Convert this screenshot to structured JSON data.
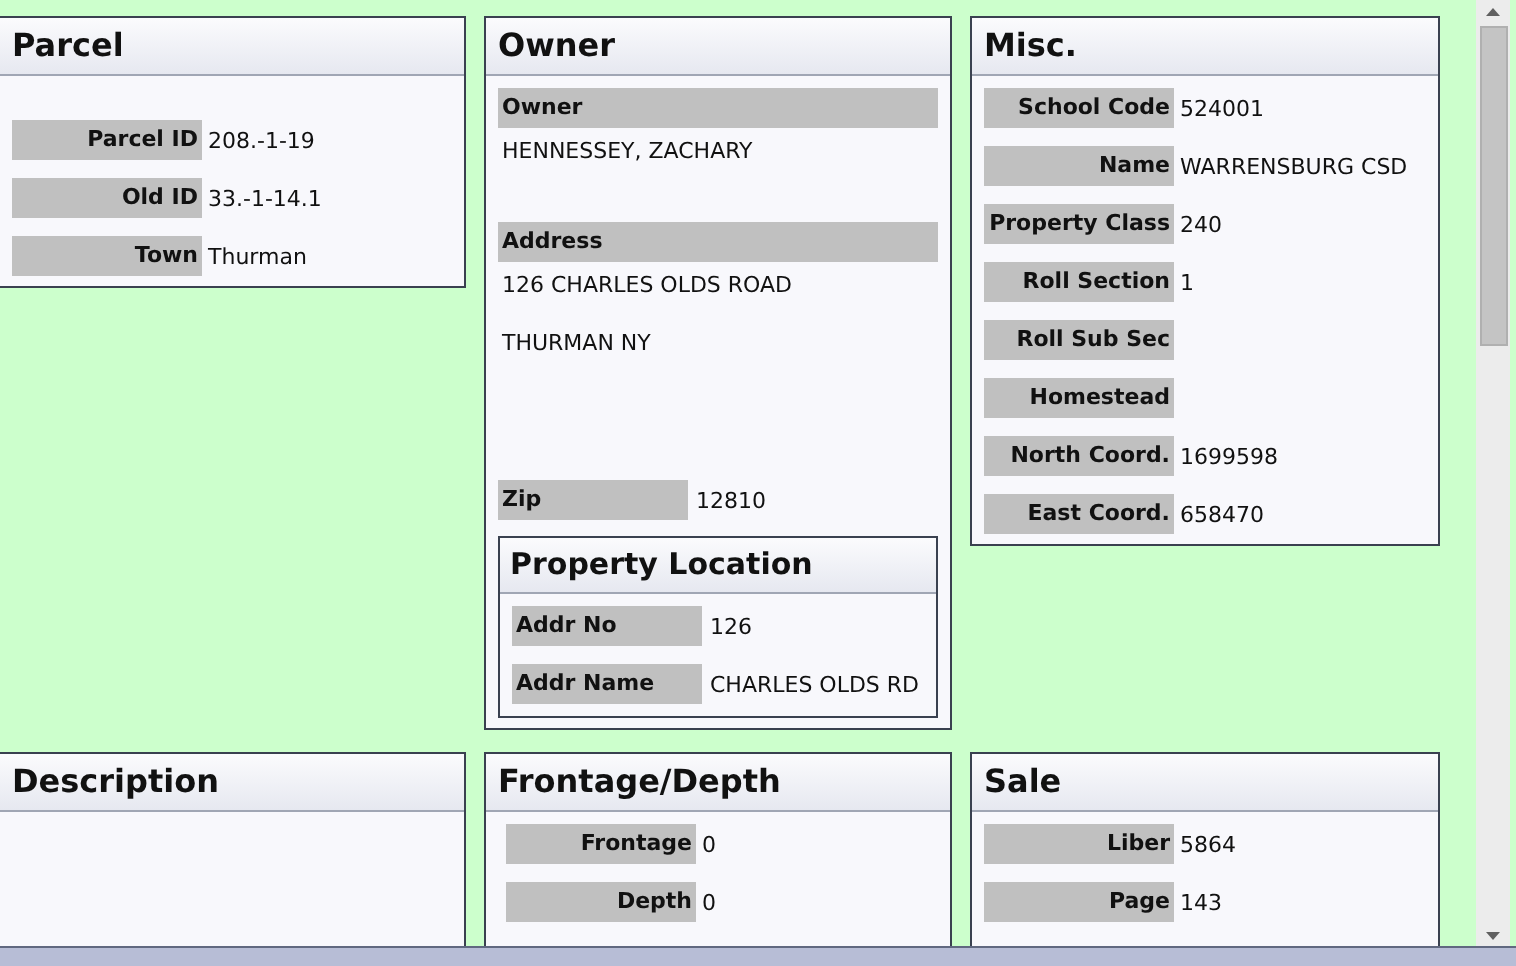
{
  "panels": [
    {
      "title": "Parcel",
      "fields": [
        {
          "kind": "inline",
          "label": "Parcel ID",
          "value": "208.-1-19"
        },
        {
          "kind": "inline",
          "label": "Old ID",
          "value": "33.-1-14.1"
        },
        {
          "kind": "inline",
          "label": "Town",
          "value": "Thurman"
        }
      ]
    },
    {
      "title": "Owner",
      "fields": [
        {
          "kind": "stacked",
          "label": "Owner",
          "lines": [
            "HENNESSEY, ZACHARY"
          ]
        },
        {
          "kind": "stacked",
          "label": "Address",
          "lines": [
            "126 CHARLES OLDS ROAD",
            "THURMAN NY"
          ]
        },
        {
          "kind": "inline-left",
          "label": "Zip",
          "value": "12810"
        }
      ],
      "subpanel": {
        "title": "Property Location",
        "fields": [
          {
            "kind": "inline-left",
            "label": "Addr No",
            "value": "126"
          },
          {
            "kind": "inline-left",
            "label": "Addr Name",
            "value": "CHARLES OLDS RD"
          }
        ]
      }
    },
    {
      "title": "Misc.",
      "fields": [
        {
          "kind": "inline",
          "label": "School Code",
          "value": "524001"
        },
        {
          "kind": "inline",
          "label": "Name",
          "value": "WARRENSBURG CSD"
        },
        {
          "kind": "inline",
          "label": "Property Class",
          "value": "240"
        },
        {
          "kind": "inline",
          "label": "Roll Section",
          "value": "1"
        },
        {
          "kind": "inline",
          "label": "Roll Sub Sec"
        },
        {
          "kind": "inline",
          "label": "Homestead"
        },
        {
          "kind": "inline",
          "label": "North Coord.",
          "value": "1699598"
        },
        {
          "kind": "inline",
          "label": "East Coord.",
          "value": "658470"
        }
      ]
    },
    {
      "title": "Description"
    },
    {
      "title": "Frontage/Depth",
      "fields": [
        {
          "kind": "inline",
          "label": "Frontage",
          "value": "0"
        },
        {
          "kind": "inline",
          "label": "Depth",
          "value": "0"
        }
      ]
    },
    {
      "title": "Sale",
      "fields": [
        {
          "kind": "inline",
          "label": "Liber",
          "value": "5864"
        },
        {
          "kind": "inline",
          "label": "Page",
          "value": "143"
        }
      ]
    }
  ]
}
